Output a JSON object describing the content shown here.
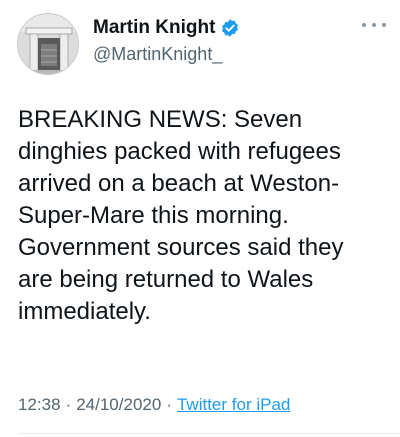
{
  "author": {
    "display_name": "Martin Knight",
    "handle": "@MartinKnight_",
    "verified": true,
    "avatar_icon": "fireplace-photo-avatar"
  },
  "menu": {
    "more_icon": "ellipsis-icon"
  },
  "tweet": {
    "text": "BREAKING NEWS: Seven\ndinghies packed with refugees\narrived on a beach at Weston-\nSuper-Mare this morning.\nGovernment sources said they\nare being returned to Wales\nimmediately.",
    "time": "12:38",
    "date": "24/10/2020",
    "separator": "·",
    "source": "Twitter for iPad"
  },
  "colors": {
    "verified_badge": "#1d9bf0",
    "link": "#1d9bf0",
    "secondary_text": "#536471"
  }
}
